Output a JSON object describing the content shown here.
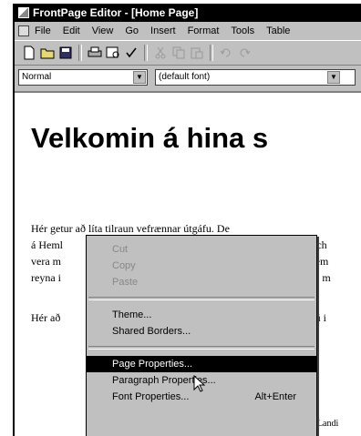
{
  "window": {
    "title": "FrontPage Editor - [Home Page]"
  },
  "menubar": {
    "items": [
      "File",
      "Edit",
      "View",
      "Go",
      "Insert",
      "Format",
      "Tools",
      "Table"
    ]
  },
  "format_bar": {
    "style_value": "Normal",
    "font_value": "(default font)"
  },
  "document": {
    "heading": "Velkomin á hina s",
    "paragraph_lines": [
      "Hér getur að líta tilraun vefrænnar útgáfu. De",
      "á Heml",
      "vera m",
      "reyna i",
      "Hér að"
    ],
    "paragraph_right_fragments": [
      "slich",
      "sem",
      "m m",
      "sú i"
    ],
    "bottom_fragment": "Upplýsingar Landi"
  },
  "context_menu": {
    "groups": [
      [
        {
          "label": "Cut",
          "enabled": false
        },
        {
          "label": "Copy",
          "enabled": false
        },
        {
          "label": "Paste",
          "enabled": false
        }
      ],
      [
        {
          "label": "Theme...",
          "enabled": true
        },
        {
          "label": "Shared Borders...",
          "enabled": true
        }
      ],
      [
        {
          "label": "Page Properties...",
          "enabled": true,
          "selected": true
        },
        {
          "label": "Paragraph Properties...",
          "enabled": true
        },
        {
          "label": "Font Properties...",
          "enabled": true,
          "shortcut": "Alt+Enter"
        }
      ]
    ]
  },
  "colors": {
    "titlebar": "#000000",
    "chrome": "#c0c0c0",
    "selection": "#000000"
  }
}
